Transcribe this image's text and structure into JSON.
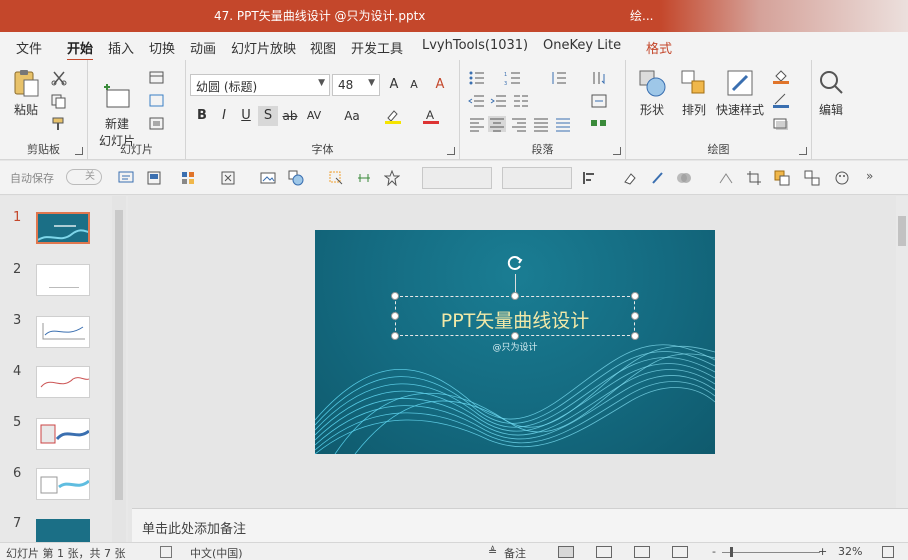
{
  "titlebar": {
    "title": "47. PPT矢量曲线设计 @只为设计.pptx",
    "right_label": "绘..."
  },
  "tabs": [
    "文件",
    "开始",
    "插入",
    "切换",
    "动画",
    "幻灯片放映",
    "视图",
    "开发工具",
    "LvyhTools(1031)",
    "OneKey Lite",
    "格式"
  ],
  "ribbon": {
    "clipboard": {
      "label": "剪贴板",
      "paste": "粘贴"
    },
    "slides": {
      "label": "幻灯片",
      "new_slide": "新建\n幻灯片"
    },
    "font": {
      "label": "字体",
      "font_name": "幼圆 (标题)",
      "font_size": "48",
      "bold": "B",
      "italic": "I",
      "underline": "U",
      "shadow": "S",
      "strike": "ab",
      "spacing": "AV",
      "case": "Aa",
      "grow": "A",
      "shrink": "A",
      "clear": "A"
    },
    "paragraph": {
      "label": "段落"
    },
    "drawing": {
      "label": "绘图",
      "shapes": "形状",
      "arrange": "排列",
      "quick_styles": "快速样式"
    },
    "editing": {
      "label": "编辑"
    }
  },
  "qat": {
    "autosave": "自动保存",
    "autosave_state": "关"
  },
  "thumbnails": [
    "1",
    "2",
    "3",
    "4",
    "5",
    "6",
    "7"
  ],
  "slide": {
    "title": "PPT矢量曲线设计",
    "subtitle": "@只为设计"
  },
  "notes": {
    "placeholder": "单击此处添加备注"
  },
  "status": {
    "slide_info": "幻灯片 第 1 张，共 7 张",
    "language": "中文(中国)",
    "notes_btn": "备注",
    "zoom": "32%",
    "minus": "-",
    "plus": "+"
  },
  "colors": {
    "accent": "#c4472b",
    "slide_bg": "#146a80",
    "title_text": "#f2e9a8"
  }
}
